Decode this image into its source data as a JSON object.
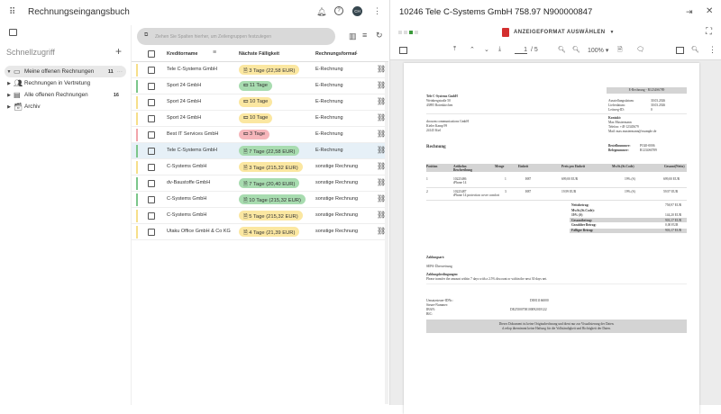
{
  "app": {
    "title": "Rechnungseingangsbuch",
    "avatar": "CH"
  },
  "sidebar": {
    "heading": "Schnellzugriff",
    "items": [
      {
        "label": "Meine offenen Rechnungen",
        "count": "11",
        "more": "···"
      },
      {
        "label": "Rechnungen in Vertretung"
      },
      {
        "label": "Alle offenen Rechnungen",
        "count": "16"
      },
      {
        "label": "Archiv"
      }
    ]
  },
  "list": {
    "search_placeholder": "Ziehen Sie Spalten hierher, um Zeilengruppen festzulegen",
    "columns": [
      "Kreditorname",
      "Nächste Fälligkeit",
      "Rechnungsformat"
    ],
    "rows": [
      {
        "name": "Tele C-Systems GmbH",
        "due": "3 Tage (22,58 EUR)",
        "format": "E-Rechnung",
        "status": "yellow",
        "icon": "doc"
      },
      {
        "name": "Sport 24 GmbH",
        "due": "11 Tage",
        "format": "E-Rechnung",
        "status": "green",
        "icon": "cash"
      },
      {
        "name": "Sport 24 GmbH",
        "due": "10 Tage",
        "format": "E-Rechnung",
        "status": "yellow",
        "icon": "cash"
      },
      {
        "name": "Sport 24 GmbH",
        "due": "10 Tage",
        "format": "E-Rechnung",
        "status": "yellow",
        "icon": "cash"
      },
      {
        "name": "Best IT Services GmbH",
        "due": "3 Tage",
        "format": "E-Rechnung",
        "status": "red",
        "icon": "cash"
      },
      {
        "name": "Tele C-Systems GmbH",
        "due": "7 Tage (22,58 EUR)",
        "format": "E-Rechnung",
        "status": "green",
        "icon": "doc",
        "selected": true
      },
      {
        "name": "C-Systems GmbH",
        "due": "3 Tage (215,32 EUR)",
        "format": "sonstige Rechnung",
        "status": "yellow",
        "icon": "doc"
      },
      {
        "name": "dv-Baustoffe GmbH",
        "due": "7 Tage (20,40 EUR)",
        "format": "sonstige Rechnung",
        "status": "green",
        "icon": "doc"
      },
      {
        "name": "C-Systems GmbH",
        "due": "10 Tage (215,32 EUR)",
        "format": "sonstige Rechnung",
        "status": "green",
        "icon": "doc"
      },
      {
        "name": "C-Systems GmbH",
        "due": "5 Tage (215,32 EUR)",
        "format": "sonstige Rechnung",
        "status": "yellow",
        "icon": "doc"
      },
      {
        "name": "Utaku Office GmbH & Co KG",
        "due": "4 Tage (21,39 EUR)",
        "format": "sonstige Rechnung",
        "status": "yellow",
        "icon": "doc"
      }
    ]
  },
  "colors": {
    "yellow": "#fbe7a1",
    "yellow_bar": "#f6df8a",
    "green": "#a8dcb0",
    "green_bar": "#7cc68a",
    "red": "#f6b6bb",
    "red_bar": "#f2a5ab",
    "selected": "#e6f0f7"
  },
  "viewer": {
    "title": "10246 Tele C-Systems GmbH 758.97 N900000847",
    "format_button": "ANZEIGEFORMAT AUSWÄHLEN",
    "page": "1",
    "pages": "/ 5",
    "zoom": "100%"
  },
  "invoice": {
    "header": "E-Rechnung - R1234S6789",
    "seller": [
      "Tele C-Systems GmbH",
      "Weinbergstraße 50",
      "43895 Rotenkirchen"
    ],
    "dates": [
      [
        "Ausstellungsdatum:",
        "30.03.2026"
      ],
      [
        "Lieferdatum:",
        "30.03.2026"
      ],
      [
        "Leitweg-ID:",
        "0"
      ]
    ],
    "buyer": [
      "docuom communications GmbH",
      "Kieler Kamp 99",
      "24145 Kiel"
    ],
    "contact": [
      "Kontakt:",
      "Max Mustermann",
      "Telefon: +49 12345679",
      "Mail: max.mustermann@example.de"
    ],
    "doc_title": "Rechnung",
    "refs": [
      [
        "Bestellnummer:",
        "PO20-0006"
      ],
      [
        "Belegnummer:",
        "R1234S6789"
      ]
    ],
    "table_header": [
      "Position",
      "Artikelnr. Beschreibung",
      "Menge",
      "Einheit",
      "Preis pro Einheit",
      "MwSt.(St.Code)",
      "Gesamt(Netto)"
    ],
    "items": [
      [
        "1",
        "10225486",
        "iPhone 14",
        "1",
        "H87",
        "699,00 EUR",
        "19% (S)",
        "699,00 EUR"
      ],
      [
        "2",
        "10225487",
        "iPhone 14 protection cover comfort",
        "3",
        "H87",
        "19,99 EUR",
        "19% (S)",
        "59,97 EUR"
      ]
    ],
    "totals": [
      [
        "Nettobetrag:",
        "758,97 EUR"
      ],
      [
        "MwSt.(St.Code):",
        ""
      ],
      [
        "19% (S)",
        "144,20 EUR"
      ],
      [
        "Gesamtbetrag:",
        "903,17 EUR"
      ],
      [
        "Gezahlter Betrag:",
        "0,00 EUR"
      ],
      [
        "Fälliger Betrag:",
        "903,17 EUR"
      ]
    ],
    "payment_label": "Zahlungsart:",
    "payment": "SEPA-Überweisung",
    "terms_label": "Zahlungsbedingungen:",
    "terms": "Please transfer the amount within 7 days with a 2.5% discount or within the next 30 days net.",
    "footer_ids": [
      [
        "Umsatzsteuer-IDNr.:",
        "DE811166000"
      ],
      [
        "Steuer-Nummer:",
        ""
      ],
      [
        "IBAN:",
        "DE25500700100092018122"
      ],
      [
        "BIC:",
        ""
      ]
    ],
    "disclaimer": [
      "Dieses Dokument ist keine Originalrechnung und dient nur zur Visualisierung der Daten.",
      "d.velop übernimmt keine Haftung für die Vollständigkeit und Richtigkeit der Daten."
    ]
  }
}
